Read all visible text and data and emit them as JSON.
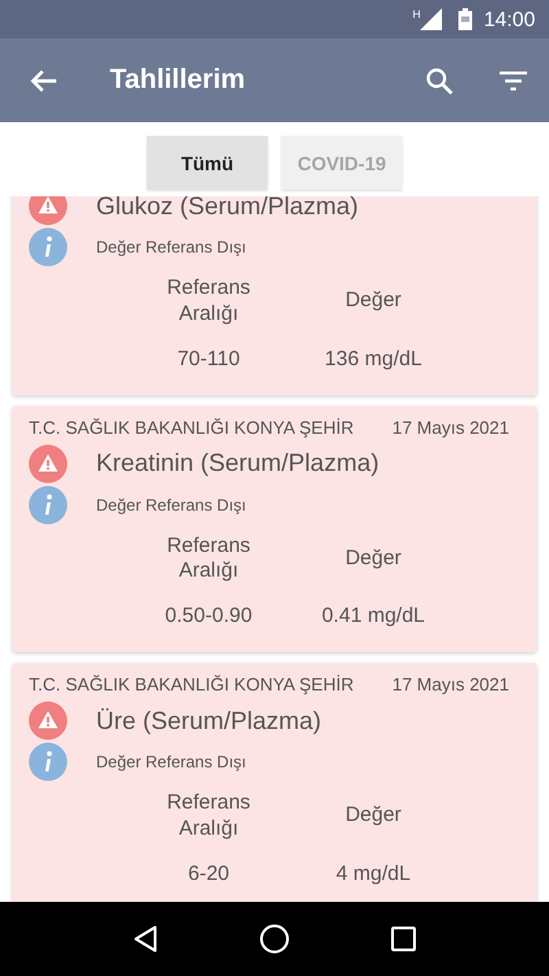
{
  "status_bar": {
    "network": "H",
    "time": "14:00"
  },
  "app_bar": {
    "title": "Tahlillerim"
  },
  "filters": [
    {
      "label": "Tümü",
      "selected": true
    },
    {
      "label": "COVID-19",
      "selected": false
    }
  ],
  "results": [
    {
      "title": "Glukoz (Serum/Plazma)",
      "status": "Değer Referans Dışı",
      "column_headers": [
        "Referans Aralığı",
        "Değer"
      ],
      "range": "70-110",
      "value": "136 mg/dL"
    },
    {
      "source": "T.C. SAĞLIK BAKANLIĞI KONYA ŞEHİR",
      "date": "17 Mayıs 2021",
      "title": "Kreatinin (Serum/Plazma)",
      "status": "Değer Referans Dışı",
      "column_headers": [
        "Referans Aralığı",
        "Değer"
      ],
      "range": "0.50-0.90",
      "value": "0.41 mg/dL"
    },
    {
      "source": "T.C. SAĞLIK BAKANLIĞI KONYA ŞEHİR",
      "date": "17 Mayıs 2021",
      "title": "Üre (Serum/Plazma)",
      "status": "Değer Referans Dışı",
      "column_headers": [
        "Referans Aralığı",
        "Değer"
      ],
      "range": "6-20",
      "value": "4 mg/dL"
    }
  ]
}
